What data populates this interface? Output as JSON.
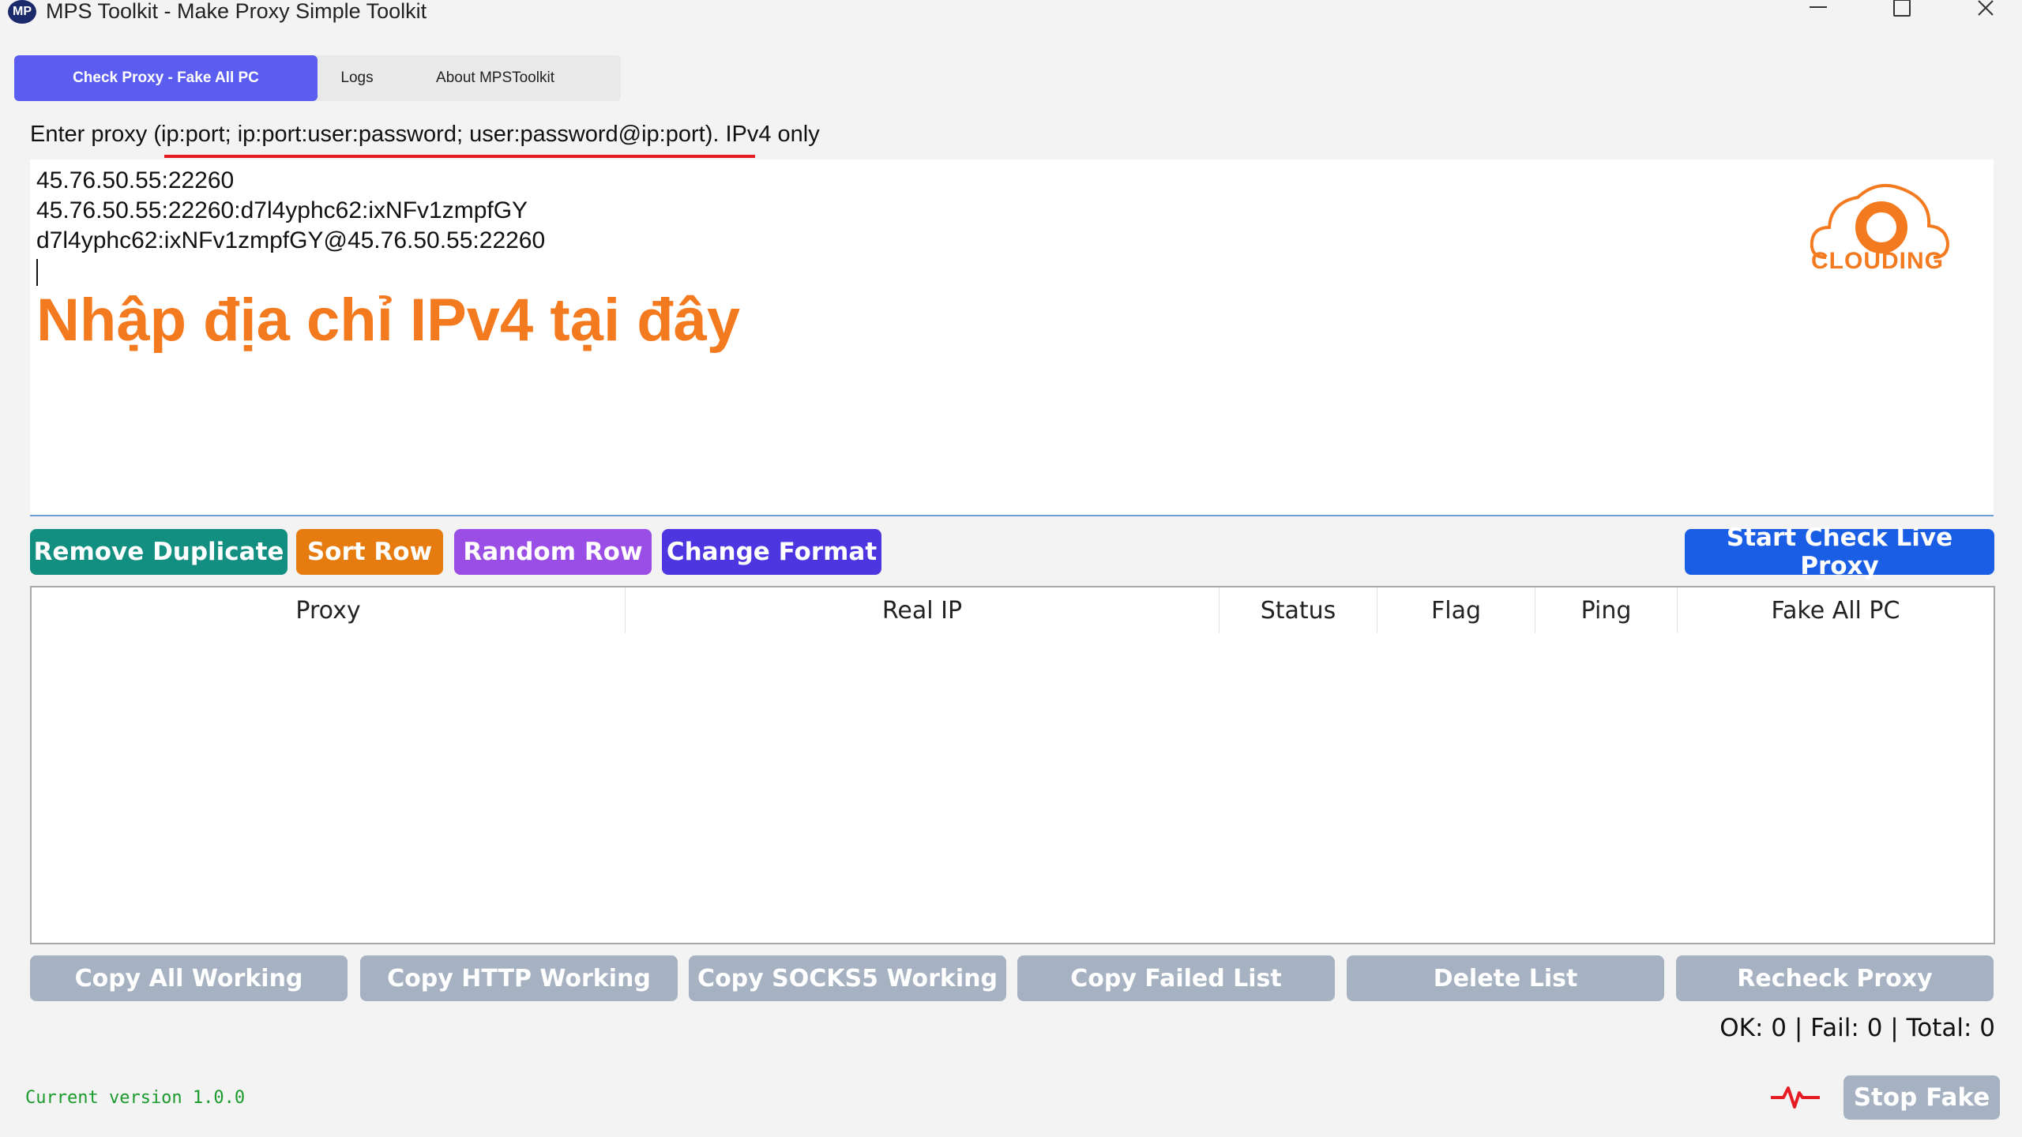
{
  "window": {
    "title": "MPS Toolkit - Make Proxy Simple Toolkit",
    "logo_text": "MP"
  },
  "tabs": [
    {
      "label": "Check Proxy - Fake All PC",
      "active": true
    },
    {
      "label": "Logs",
      "active": false
    },
    {
      "label": "About MPSToolkit",
      "active": false
    }
  ],
  "instruction": "Enter proxy (ip:port; ip:port:user:password; user:password@ip:port). IPv4 only",
  "proxy_input": {
    "lines": [
      "45.76.50.55:22260",
      "45.76.50.55:22260:d7l4yphc62:ixNFv1zmpfGY",
      "d7l4yphc62:ixNFv1zmpfGY@45.76.50.55:22260"
    ],
    "overlay": "Nhập địa chỉ IPv4 tại đây",
    "brand": "CLOUDING"
  },
  "actions": {
    "remove_duplicate": "Remove Duplicate",
    "sort_row": "Sort Row",
    "random_row": "Random Row",
    "change_format": "Change Format",
    "start_check": "Start Check Live Proxy"
  },
  "table": {
    "columns": [
      "Proxy",
      "Real IP",
      "Status",
      "Flag",
      "Ping",
      "Fake All PC"
    ],
    "rows": []
  },
  "bottom_actions": {
    "copy_all": "Copy All Working",
    "copy_http": "Copy HTTP Working",
    "copy_socks5": "Copy SOCKS5 Working",
    "copy_failed": "Copy Failed List",
    "delete_list": "Delete List",
    "recheck": "Recheck Proxy"
  },
  "stats": "OK: 0 | Fail: 0 | Total: 0",
  "version": "Current version 1.0.0",
  "stop_fake": "Stop Fake",
  "colors": {
    "tab_active": "#5b5df0",
    "remove": "#128f80",
    "sort": "#e67c10",
    "random": "#9a4ee6",
    "change": "#4d35e0",
    "start": "#1b5ee6",
    "disabled": "#a6b2c2",
    "brand": "#f47a20"
  }
}
